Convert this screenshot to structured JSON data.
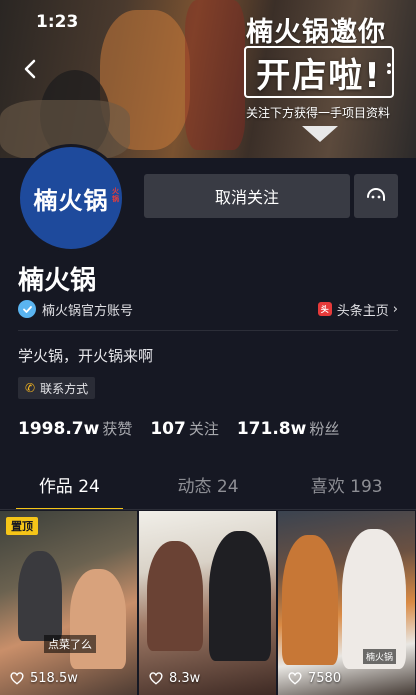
{
  "status_bar": {
    "time": "1:23"
  },
  "cover": {
    "promo_title": "楠火锅邀你",
    "promo_main": "开店啦!",
    "promo_sub": "关注下方获得一手项目资料"
  },
  "avatar": {
    "text": "楠火锅",
    "side_badge": "火锅"
  },
  "actions": {
    "follow_label": "取消关注"
  },
  "profile": {
    "nickname": "楠火锅",
    "verified_label": "楠火锅官方账号",
    "toutiao_label": "头条主页",
    "bio": "学火锅，开火锅来啊",
    "contact_label": "联系方式"
  },
  "stats": [
    {
      "value": "1998.7w",
      "label": "获赞"
    },
    {
      "value": "107",
      "label": "关注"
    },
    {
      "value": "171.8w",
      "label": "粉丝"
    }
  ],
  "tabs": [
    {
      "label": "作品 24",
      "active": true
    },
    {
      "label": "动态 24",
      "active": false
    },
    {
      "label": "喜欢 193",
      "active": false
    }
  ],
  "videos": [
    {
      "pinned_label": "置顶",
      "caption": "点菜了么",
      "likes": "518.5w"
    },
    {
      "likes": "8.3w"
    },
    {
      "caption": "楠火锅",
      "likes": "7580"
    }
  ],
  "colors": {
    "background": "#161823",
    "accent": "#f5c518",
    "button": "#393b44",
    "avatar_bg": "#1e4a9c"
  }
}
